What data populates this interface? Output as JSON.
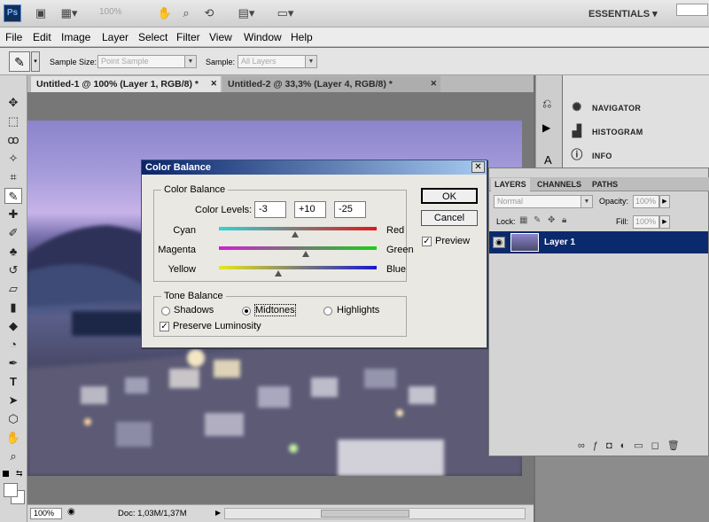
{
  "app": {
    "logo_text": "Ps",
    "zoom": "100%",
    "workspace": "ESSENTIALS"
  },
  "menu": [
    "File",
    "Edit",
    "Image",
    "Layer",
    "Select",
    "Filter",
    "View",
    "Window",
    "Help"
  ],
  "options": {
    "sample_size_label": "Sample Size:",
    "sample_size_value": "Point Sample",
    "sample_label": "Sample:",
    "sample_value": "All Layers"
  },
  "tabs": [
    {
      "label": "Untitled-1 @ 100% (Layer 1, RGB/8) *"
    },
    {
      "label": "Untitled-2 @ 33,3% (Layer 4, RGB/8) *"
    }
  ],
  "status": {
    "zoom": "100%",
    "doc": "Doc: 1,03M/1,37M"
  },
  "panels": {
    "navigator": "NAVIGATOR",
    "histogram": "HISTOGRAM",
    "info": "INFO"
  },
  "layers": {
    "tabs": [
      "LAYERS",
      "CHANNELS",
      "PATHS"
    ],
    "blend_mode": "Normal",
    "opacity_label": "Opacity:",
    "opacity": "100%",
    "lock_label": "Lock:",
    "fill_label": "Fill:",
    "fill": "100%",
    "layer_name": "Layer 1"
  },
  "dialog": {
    "title": "Color Balance",
    "group_label": "Color Balance",
    "levels_label": "Color Levels:",
    "levels": [
      "-3",
      "+10",
      "-25"
    ],
    "sliders": [
      {
        "left": "Cyan",
        "right": "Red",
        "value": -3
      },
      {
        "left": "Magenta",
        "right": "Green",
        "value": 10
      },
      {
        "left": "Yellow",
        "right": "Blue",
        "value": -25
      }
    ],
    "tone_label": "Tone Balance",
    "tones": [
      "Shadows",
      "Midtones",
      "Highlights"
    ],
    "selected_tone": "Midtones",
    "preserve": "Preserve Luminosity",
    "ok": "OK",
    "cancel": "Cancel",
    "preview": "Preview"
  }
}
